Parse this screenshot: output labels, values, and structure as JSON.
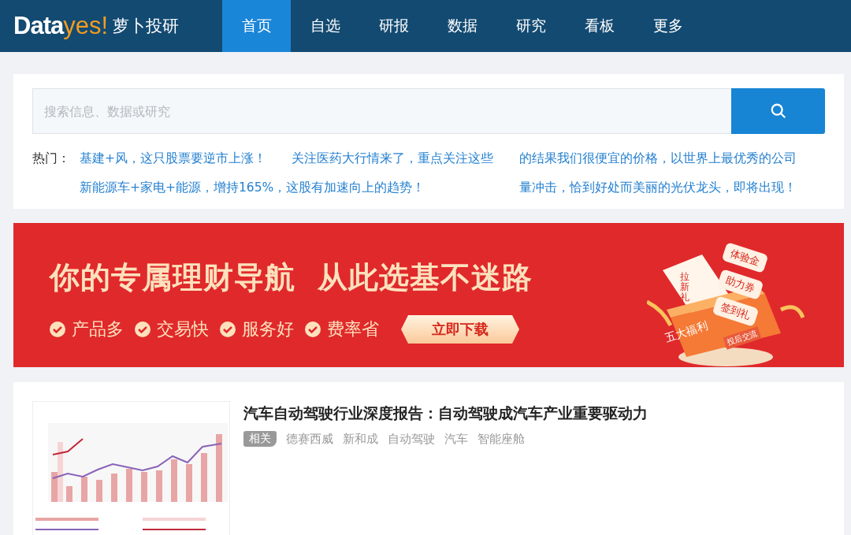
{
  "logo": {
    "data": "Data",
    "yes": "yes!",
    "name": "萝卜投研"
  },
  "nav": [
    {
      "label": "首页",
      "selected": true
    },
    {
      "label": "自选",
      "selected": false
    },
    {
      "label": "研报",
      "selected": false
    },
    {
      "label": "数据",
      "selected": false
    },
    {
      "label": "研究",
      "selected": false
    },
    {
      "label": "看板",
      "selected": false
    },
    {
      "label": "更多",
      "selected": false
    }
  ],
  "search": {
    "placeholder": "搜索信息、数据或研究"
  },
  "hot": {
    "label": "热门：",
    "topics": [
      "基建+风，这只股票要逆市上涨！",
      "关注医药大行情来了，重点关注这些",
      "的结果我们很便宜的价格，以世界上最优秀的公司",
      "新能源车+家电+能源，增持165%，这股有加速向上的趋势！",
      "量冲击，恰到好处而美丽的光伏龙头，即将出现！"
    ]
  },
  "banner": {
    "headline": "你的专属理财导航  从此选基不迷路",
    "features": [
      "产品多",
      "交易快",
      "服务好",
      "费率省"
    ],
    "button": "立即下载",
    "gift_cards": [
      "体验金",
      "助力券",
      "签到礼"
    ],
    "gift_note": "拉新礼",
    "box_label": "五大福利",
    "box_tag": "投后交流"
  },
  "reports": [
    {
      "title": "汽车自动驾驶行业深度报告：自动驾驶成汽车产业重要驱动力",
      "tag": "相关",
      "keywords": [
        "德赛西威",
        "新和成",
        "自动驾驶",
        "汽车",
        "智能座舱"
      ]
    }
  ]
}
